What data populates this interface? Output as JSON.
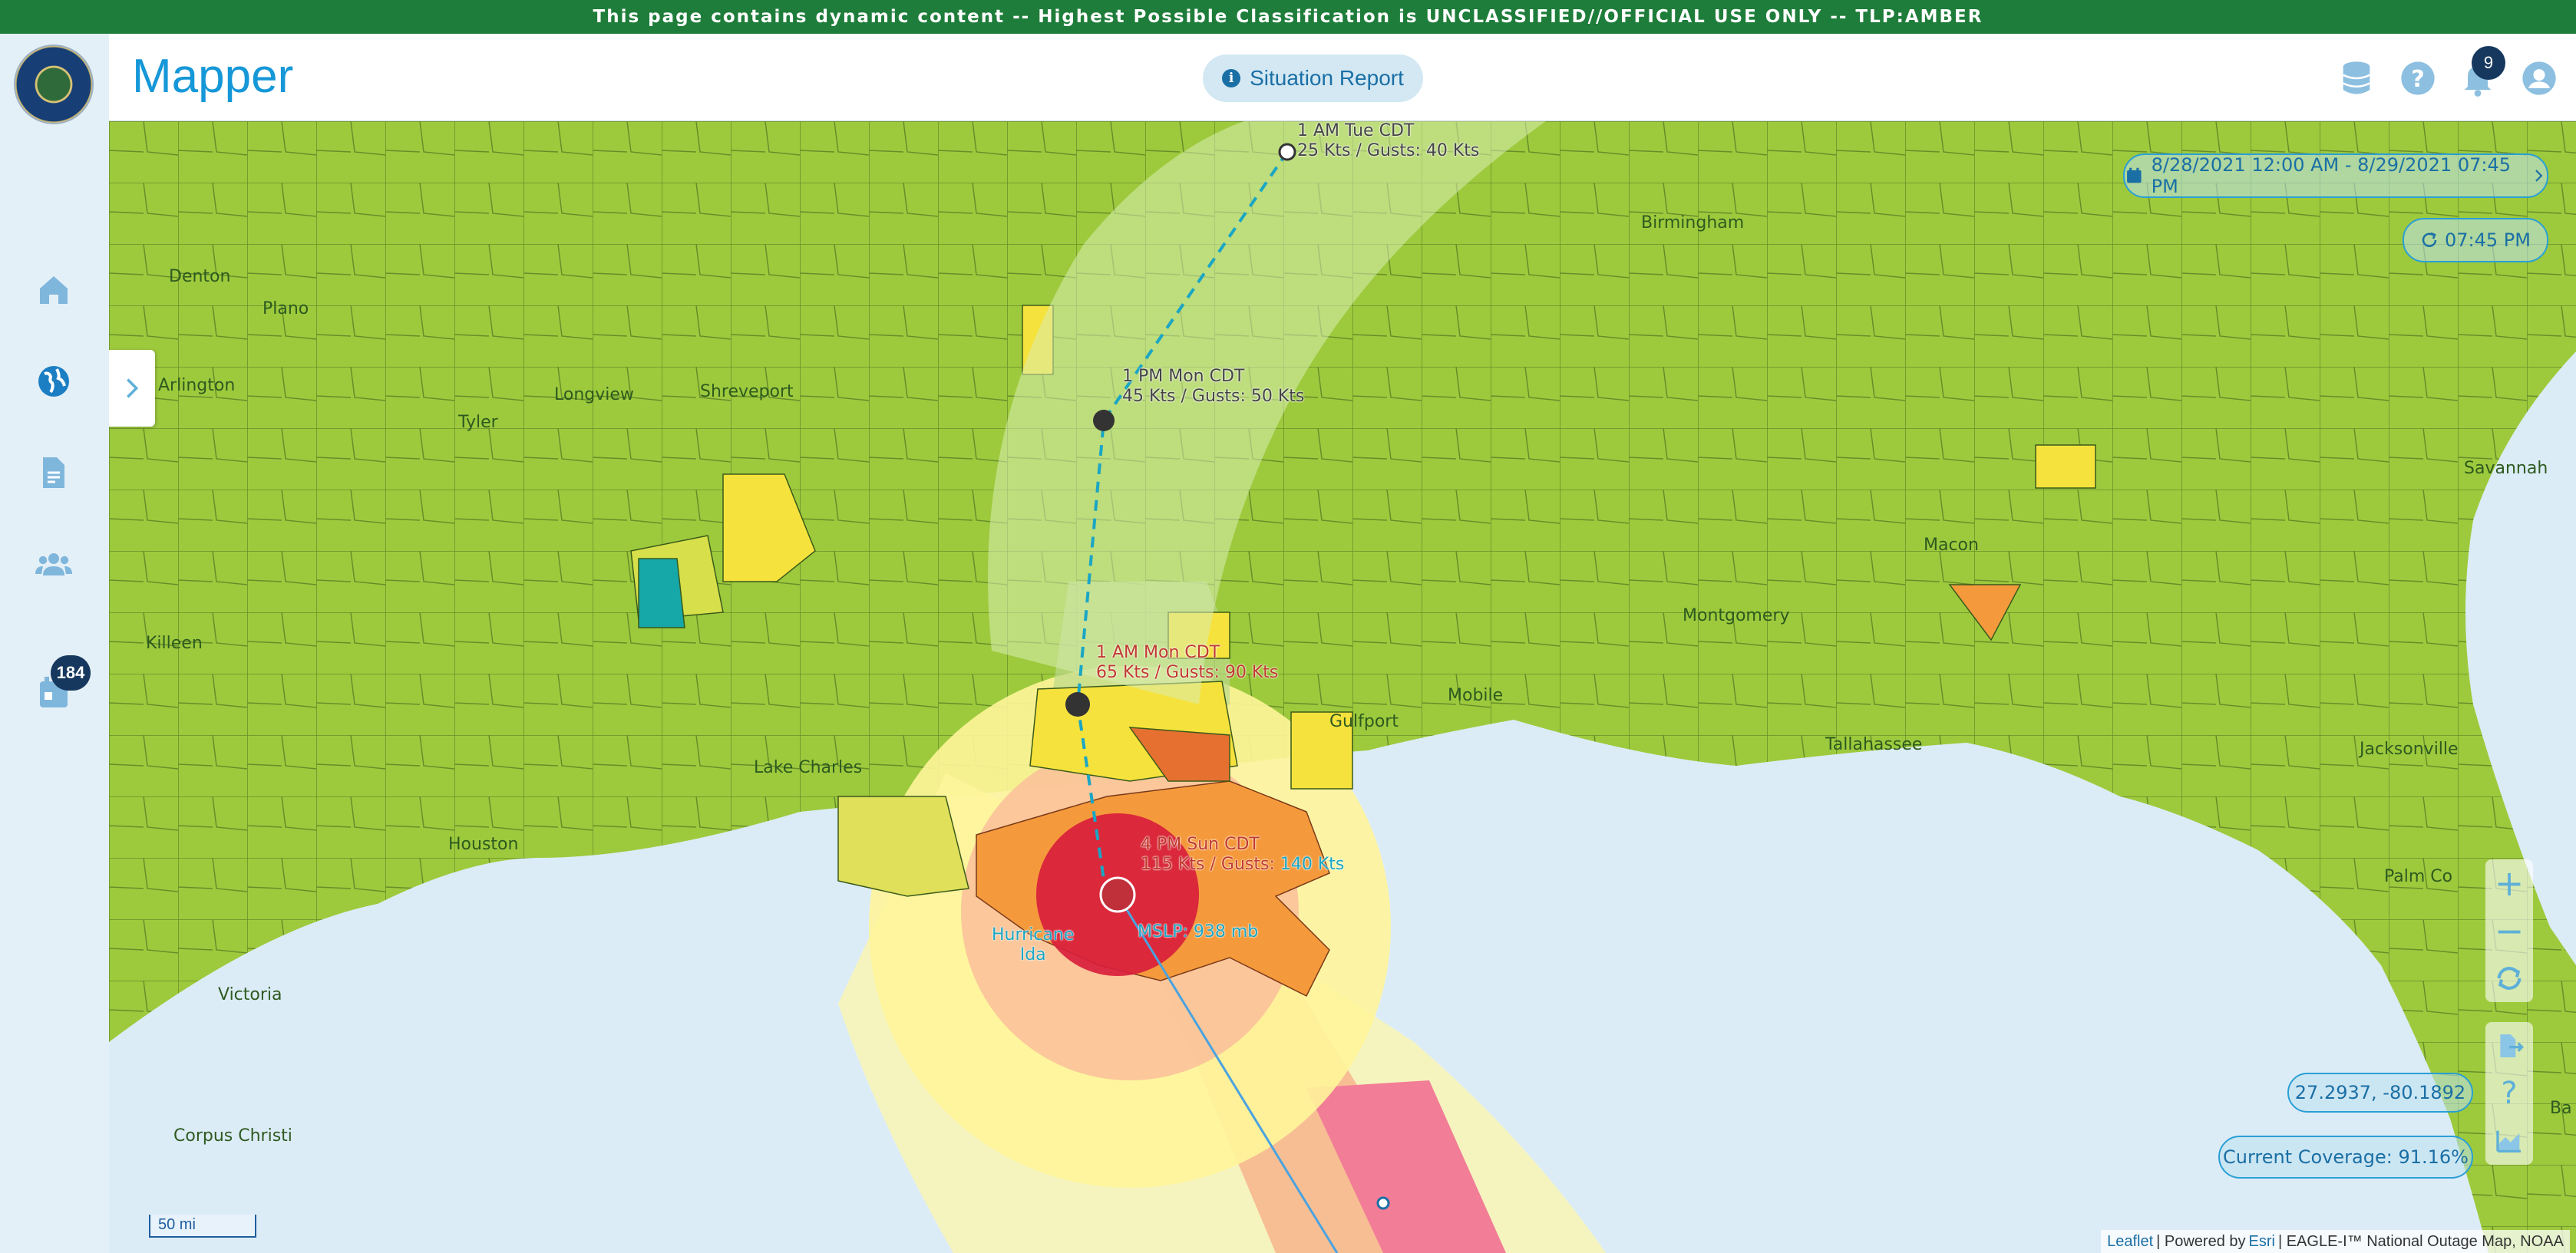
{
  "classification_banner": "This page contains dynamic content -- Highest Possible Classification is UNCLASSIFIED//OFFICIAL USE ONLY -- TLP:AMBER",
  "header": {
    "app_title": "Mapper",
    "situation_report_label": "Situation Report",
    "notification_count": "9"
  },
  "sidebar": {
    "items": [
      {
        "name": "home-icon"
      },
      {
        "name": "globe-icon"
      },
      {
        "name": "document-icon"
      },
      {
        "name": "people-icon"
      },
      {
        "name": "calendar-icon"
      }
    ],
    "calendar_badge": "184"
  },
  "map": {
    "date_range": "8/28/2021 12:00 AM - 8/29/2021 07:45 PM",
    "refresh_time": "07:45 PM",
    "coordinates": "27.2937, -80.1892",
    "coverage": "Current Coverage: 91.16%",
    "scale_label": "50 mi",
    "attribution": {
      "leaflet": "Leaflet",
      "powered_by": "| Powered by",
      "esri": "Esri",
      "sources": "| EAGLE-I™ National Outage Map, NOAA"
    },
    "hurricane_name_line1": "Hurricane",
    "hurricane_name_line2": "Ida",
    "track_points": [
      {
        "time": "1 AM Tue CDT",
        "wind": "25 Kts / Gusts: 40 Kts"
      },
      {
        "time": "1 PM Mon CDT",
        "wind": "45 Kts / Gusts: 50 Kts"
      },
      {
        "time": "1 AM Mon CDT",
        "wind": "65 Kts / Gusts: 90 Kts"
      },
      {
        "time": "4 PM Sun CDT",
        "wind_part1": "115 Kts / Gusts:",
        "wind_part2": "140 Kts",
        "pressure": "MSLP: 938 mb"
      }
    ],
    "place_labels": [
      "Denton",
      "Plano",
      "Arlington",
      "Tyler",
      "Shreveport",
      "Longview",
      "Killeen",
      "Lake Charles",
      "Houston",
      "Victoria",
      "Corpus Christi",
      "Jacksonville",
      "Savannah",
      "Palm Co",
      "Birmingham",
      "Macon",
      "Tallahassee",
      "Gulfport",
      "Mobile",
      "Montgomery",
      "Ba"
    ],
    "colors": {
      "land": "#9dca3d",
      "water": "#dcecf7",
      "outage_low": "#f6e23c",
      "outage_mid": "#f59a3c",
      "outage_high": "#e0403a",
      "outage_extreme": "#d81e3c",
      "outage_teal": "#16a7a8",
      "cone_inner": "#f58aa0",
      "cone_mid": "#fbc29a",
      "cone_outer": "#fff59a",
      "accent": "#1597d8"
    }
  }
}
